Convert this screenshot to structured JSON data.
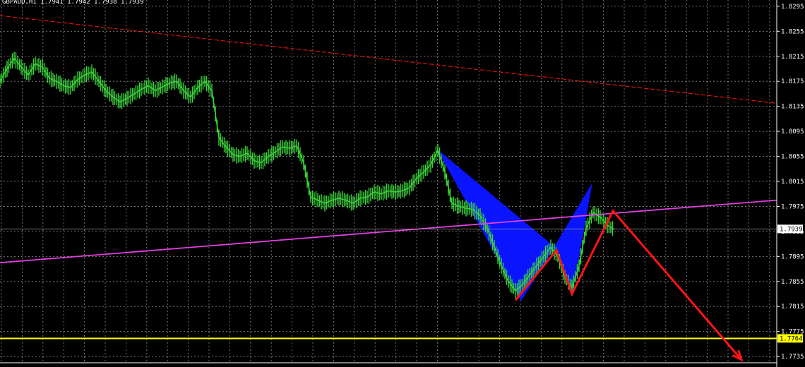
{
  "window": {
    "symbol_line": "GBPAUD,H1  1.7941 1.7942 1.7938 1.7939"
  },
  "colors": {
    "background": "#000000",
    "grid": "#c8c8c8",
    "candle": "#3ad13a",
    "pattern_fill": "#0a14ff",
    "pattern_line": "#ff1414",
    "downtrend_line": "#e01010",
    "uptrend_line": "#e040e0",
    "support_line": "#ffff00",
    "current_price_line": "#a0a0a0",
    "axis_text": "#ffffff"
  },
  "chart_data": {
    "type": "line",
    "title": "",
    "instrument": "GBPAUD",
    "timeframe": "H1",
    "ylim": [
      1.7725,
      1.8305
    ],
    "y_ticks": [
      "1.8295",
      "1.8255",
      "1.8215",
      "1.8175",
      "1.8135",
      "1.8095",
      "1.8055",
      "1.8015",
      "1.7975",
      "1.7935",
      "1.7895",
      "1.7855",
      "1.7815",
      "1.7775",
      "1.7735"
    ],
    "current_price": "1.7939",
    "support_level": "1.7764",
    "grid": true,
    "series": [
      {
        "kind": "price",
        "x": [
          0,
          10,
          20,
          30,
          40,
          50,
          60,
          70,
          80,
          90,
          100,
          110,
          120,
          130,
          140,
          150,
          160,
          170,
          180,
          190,
          200,
          210,
          220,
          230,
          240,
          250,
          260,
          270,
          280,
          290,
          300,
          310,
          320,
          330,
          340,
          350,
          360,
          370,
          380,
          390,
          400,
          410,
          420,
          430,
          440,
          450,
          460,
          470,
          480,
          490,
          500,
          510,
          520,
          530,
          540,
          550,
          560,
          570,
          580,
          590,
          600,
          610,
          620,
          630,
          640,
          650,
          660,
          670,
          680,
          690,
          700,
          710,
          720,
          730,
          740,
          750,
          760,
          770,
          780,
          790,
          800,
          810,
          820,
          830,
          840,
          850,
          860,
          870
        ],
        "values": [
          1.8175,
          1.8195,
          1.8212,
          1.8198,
          1.8185,
          1.8203,
          1.8198,
          1.818,
          1.8175,
          1.8168,
          1.8165,
          1.8178,
          1.8185,
          1.819,
          1.8175,
          1.816,
          1.815,
          1.8142,
          1.8148,
          1.8155,
          1.8162,
          1.8168,
          1.816,
          1.8166,
          1.8172,
          1.8175,
          1.816,
          1.815,
          1.8165,
          1.8175,
          1.816,
          1.8085,
          1.807,
          1.8058,
          1.8055,
          1.806,
          1.8048,
          1.8045,
          1.8055,
          1.8062,
          1.807,
          1.8068,
          1.8072,
          1.8045,
          1.799,
          1.7985,
          1.798,
          1.7985,
          1.7988,
          1.7985,
          1.798,
          1.7988,
          1.799,
          1.7998,
          1.7995,
          1.8,
          1.7998,
          1.8,
          1.8005,
          1.802,
          1.803,
          1.8042,
          1.8065,
          1.803,
          1.798,
          1.7975,
          1.7972,
          1.797,
          1.796,
          1.794,
          1.791,
          1.788,
          1.7855,
          1.784,
          1.785,
          1.7865,
          1.788,
          1.7895,
          1.791,
          1.7895,
          1.7862,
          1.7845,
          1.788,
          1.794,
          1.7965,
          1.7958,
          1.7945,
          1.7938
        ]
      }
    ],
    "annotations": [
      {
        "kind": "trendline",
        "name": "downtrend",
        "style": "dashed",
        "x": [
          0,
          1100
        ],
        "y": [
          1.828,
          1.814
        ]
      },
      {
        "kind": "trendline",
        "name": "uptrend",
        "x": [
          0,
          1100
        ],
        "y": [
          1.7885,
          1.7985
        ]
      },
      {
        "kind": "hline",
        "name": "support",
        "y": 1.7764
      },
      {
        "kind": "hline",
        "name": "current",
        "y": 1.7939
      },
      {
        "kind": "pattern",
        "name": "harmonic-triangle-1",
        "x": [
          620,
          738,
          785
        ],
        "y": [
          1.8065,
          1.7825,
          1.791
        ]
      },
      {
        "kind": "pattern",
        "name": "harmonic-triangle-2",
        "x": [
          785,
          810,
          838
        ],
        "y": [
          1.791,
          1.7835,
          1.801
        ]
      },
      {
        "kind": "arrow-path",
        "name": "forecast",
        "x": [
          730,
          788,
          810,
          868,
          1050
        ],
        "y": [
          1.7825,
          1.7905,
          1.7835,
          1.7968,
          1.773
        ]
      }
    ]
  }
}
